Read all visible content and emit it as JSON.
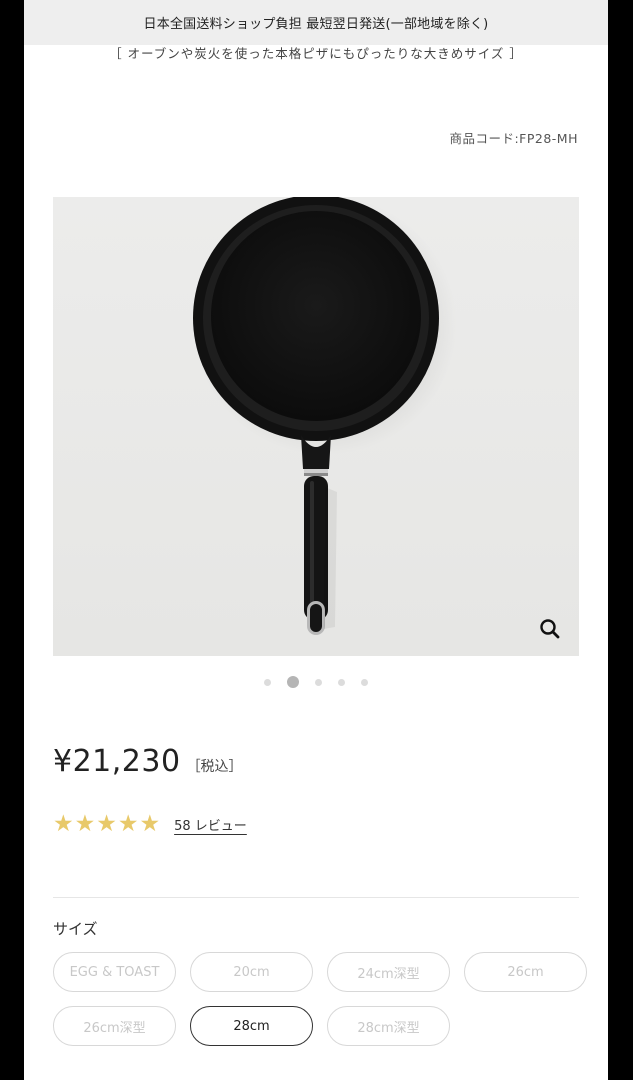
{
  "banner": {
    "text": "日本全国送料ショップ負担 最短翌日発送(一部地域を除く)"
  },
  "subtitle": "［ オーブンや炭火を使った本格ピザにもぴったりな大きめサイズ ］",
  "product_code": "商品コード:FP28-MH",
  "gallery": {
    "image_description": "black frying pan on light gray background",
    "zoom_icon": "search-icon",
    "slide_count": 5,
    "active_slide": 2
  },
  "price": {
    "amount": "¥21,230",
    "tax_note": "［税込］"
  },
  "rating": {
    "stars": 5,
    "max_stars": 5,
    "star_color": "#e8c96a",
    "review_link": "58 レビュー"
  },
  "size": {
    "label": "サイズ",
    "options": [
      {
        "label": "EGG & TOAST",
        "state": "unavailable"
      },
      {
        "label": "20cm",
        "state": "unavailable"
      },
      {
        "label": "24cm深型",
        "state": "unavailable"
      },
      {
        "label": "26cm",
        "state": "unavailable"
      },
      {
        "label": "26cm深型",
        "state": "unavailable"
      },
      {
        "label": "28cm",
        "state": "selected"
      },
      {
        "label": "28cm深型",
        "state": "unavailable"
      }
    ]
  }
}
